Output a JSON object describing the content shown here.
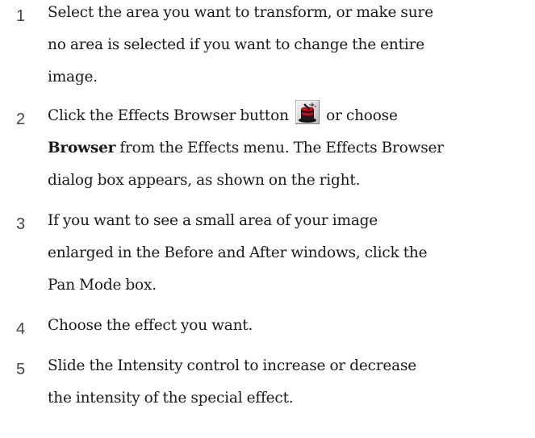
{
  "steps": [
    {
      "number": "1",
      "lines": [
        "Select the area you want to transform, or make sure",
        "no area is selected if you want to change the entire",
        "image."
      ]
    },
    {
      "number": "2",
      "line1_before_icon": "Click the Effects Browser button",
      "line1_after_icon": "or choose",
      "line2_bold": "Browser",
      "line2_rest": " from the Effects menu. The Effects Browser",
      "line3": "dialog box appears, as shown on the right.",
      "icon": "effects-browser-icon"
    },
    {
      "number": "3",
      "lines": [
        "If you want to see a small area of your image",
        "enlarged in the Before and After windows, click the",
        "Pan Mode box."
      ]
    },
    {
      "number": "4",
      "lines": [
        "Choose the effect you want."
      ]
    },
    {
      "number": "5",
      "lines": [
        "Slide the Intensity control to increase or decrease",
        "the intensity of the special effect."
      ]
    }
  ]
}
